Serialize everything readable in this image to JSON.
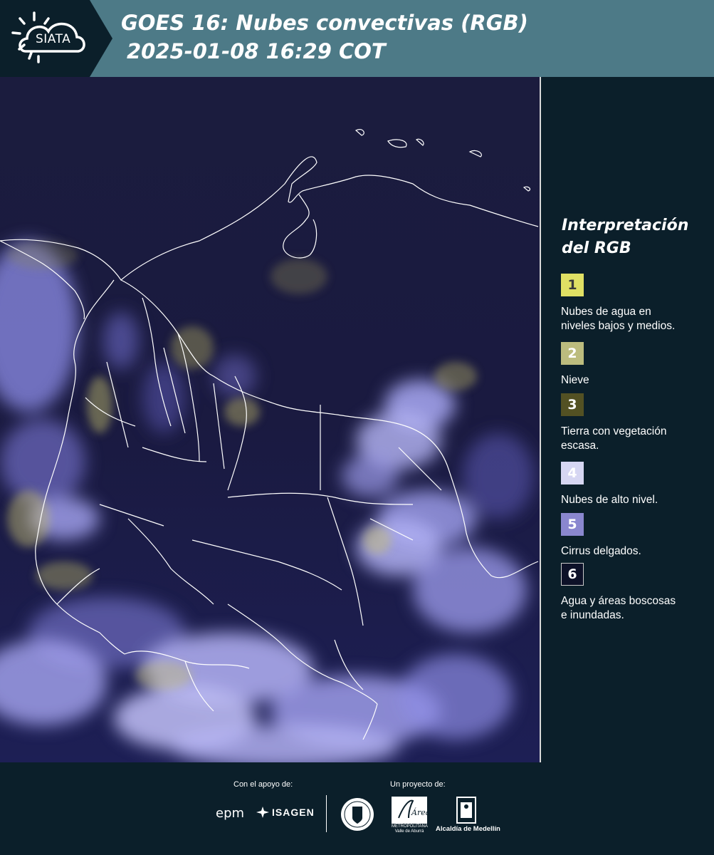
{
  "header": {
    "logo_text": "SIATA",
    "title_line1": "GOES 16: Nubes convectivas (RGB)",
    "title_line2": "2025-01-08 16:29 COT"
  },
  "legend": {
    "title_line1": "Interpretación",
    "title_line2": "del RGB",
    "items": [
      {
        "number": "1",
        "label_line1": "Nubes de agua en",
        "label_line2": "niveles bajos y medios.",
        "color": "#e0e064",
        "text_color": "#3a3a3a"
      },
      {
        "number": "2",
        "label_line1": "Nieve",
        "label_line2": "",
        "color": "#bcbc7e",
        "text_color": "#ffffff"
      },
      {
        "number": "3",
        "label_line1": "Tierra con vegetación",
        "label_line2": "escasa.",
        "color": "#535123",
        "text_color": "#ffffff"
      },
      {
        "number": "4",
        "label_line1": "Nubes de alto nivel.",
        "label_line2": "",
        "color": "#d6d6f2",
        "text_color": "#ffffff"
      },
      {
        "number": "5",
        "label_line1": "Cirrus delgados.",
        "label_line2": "",
        "color": "#8a87cf",
        "text_color": "#ffffff"
      },
      {
        "number": "6",
        "label_line1": "Agua y áreas boscosas",
        "label_line2": "e inundadas.",
        "color": "#0d1128",
        "text_color": "#ffffff"
      }
    ]
  },
  "footer": {
    "support_label": "Con el apoyo de:",
    "project_label": "Un proyecto de:",
    "epm": "epm",
    "isagen": "ISAGEN",
    "amva": "Área",
    "amva_sub1": "METROPOLITANA",
    "amva_sub2": "Valle de Aburrá",
    "alcaldia": "Alcaldía de Medellín"
  },
  "colors": {
    "header_bg": "#4d7a87",
    "panel_bg": "#0b1f2a",
    "map_dark": "#191a46",
    "cloud_high": "#a9a9f5",
    "cloud_low": "#d9d470"
  }
}
